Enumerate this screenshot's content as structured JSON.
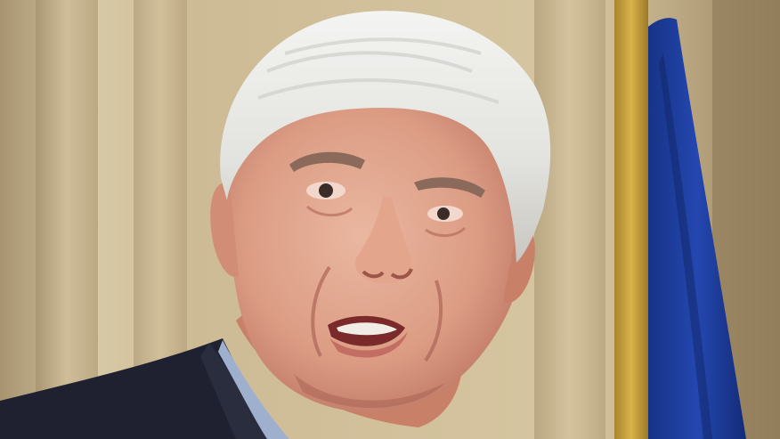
{
  "image": {
    "kind": "photograph",
    "subject": "person-portrait",
    "palette": {
      "background_light": "#d8c9a6",
      "background_dark": "#9c8762",
      "pillar": "#b9a57f",
      "hair": "#e9e9e6",
      "skin": "#e0a38b",
      "skin_shadow": "#b8705e",
      "suit": "#1f2130",
      "shirt": "#9fb0cf",
      "flag_blue": "#1f3d9e",
      "flag_gold": "#c9a23c"
    }
  }
}
